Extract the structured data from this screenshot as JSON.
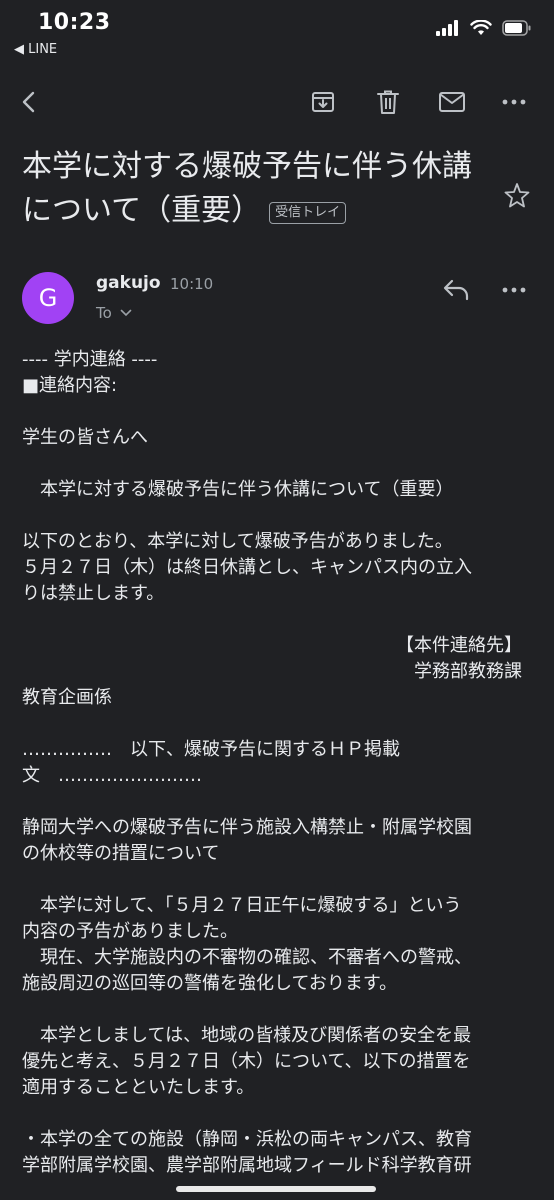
{
  "status_bar": {
    "time": "10:23",
    "back_app": "◀ LINE"
  },
  "subject": {
    "title": "本学に対する爆破予告に伴う休講について（重要）",
    "label": "受信トレイ"
  },
  "sender": {
    "avatar_letter": "G",
    "name": "gakujo",
    "time": "10:10",
    "to": "To"
  },
  "body": {
    "lines": [
      "---- 学内連絡 ----",
      "■連絡内容:",
      "",
      "学生の皆さんへ",
      "",
      "　本学に対する爆破予告に伴う休講について（重要）",
      "",
      "以下のとおり、本学に対して爆破予告がありました。",
      "５月２７日（木）は終日休講とし、キャンパス内の立入",
      "りは禁止します。",
      "",
      "【本件連絡先】",
      "学務部教務課",
      "教育企画係",
      "",
      "……………　以下、爆破予告に関するＨＰ掲載",
      "文　……………………",
      "",
      "静岡大学への爆破予告に伴う施設入構禁止・附属学校園",
      "の休校等の措置について",
      "",
      "　本学に対して、「５月２７日正午に爆破する」という",
      "内容の予告がありました。",
      "　現在、大学施設内の不審物の確認、不審者への警戒、",
      "施設周辺の巡回等の警備を強化しております。",
      "",
      "　本学としましては、地域の皆様及び関係者の安全を最",
      "優先と考え、５月２７日（木）について、以下の措置を",
      "適用することといたします。",
      "",
      "・本学の全ての施設（静岡・浜松の両キャンパス、教育",
      "学部附属学校園、農学部附属地域フィールド科学教育研"
    ]
  },
  "colors": {
    "background": "#202124",
    "avatar": "#a142f4",
    "text": "#e8eaed",
    "muted": "#9aa0a6"
  }
}
